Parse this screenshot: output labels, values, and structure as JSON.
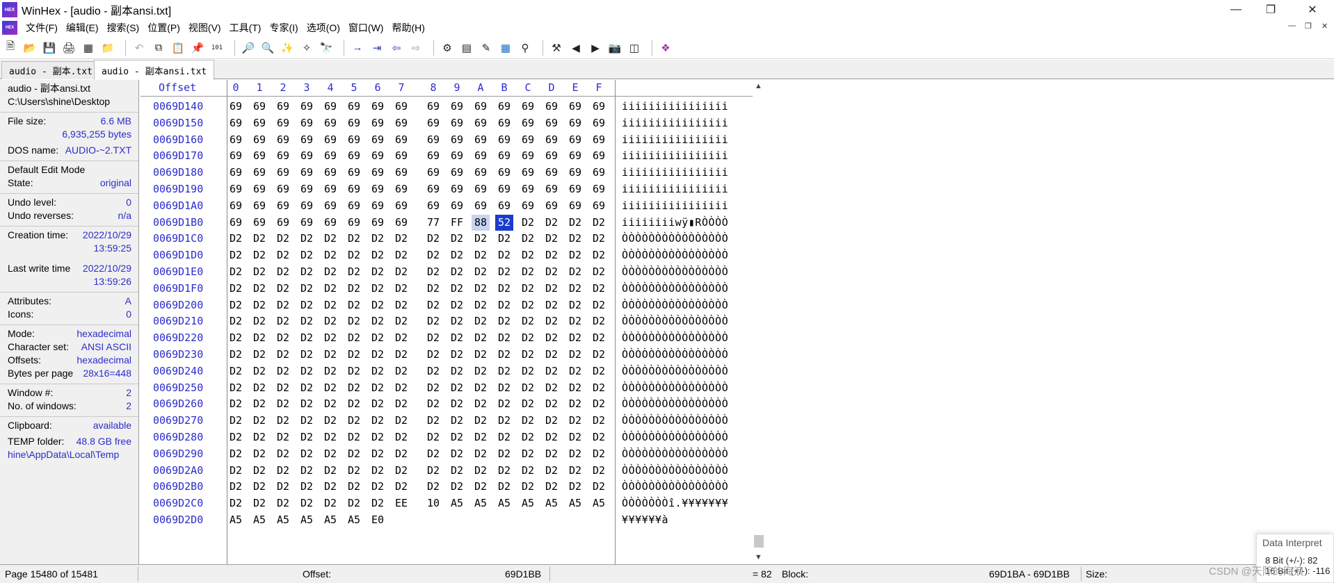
{
  "window": {
    "title": "WinHex - [audio - 副本ansi.txt]",
    "app_icon_label": "HEX",
    "controls": [
      "minimize-icon",
      "restore-icon",
      "close-icon"
    ]
  },
  "menu": {
    "items": [
      "文件(F)",
      "编辑(E)",
      "搜索(S)",
      "位置(P)",
      "视图(V)",
      "工具(T)",
      "专家(I)",
      "选项(O)",
      "窗口(W)",
      "帮助(H)"
    ]
  },
  "tabs": [
    {
      "label": "audio - 副本.txt",
      "active": false
    },
    {
      "label": "audio - 副本ansi.txt",
      "active": true
    }
  ],
  "info": {
    "file_name": "audio - 副本ansi.txt",
    "file_path": "C:\\Users\\shine\\Desktop",
    "file_size_label": "File size:",
    "file_size_mb": "6.6 MB",
    "file_size_bytes": "6,935,255 bytes",
    "dos_name_label": "DOS name:",
    "dos_name": "AUDIO-~2.TXT",
    "edit_mode": "Default Edit Mode",
    "state_label": "State:",
    "state": "original",
    "undo_level_label": "Undo level:",
    "undo_level": "0",
    "undo_reverses_label": "Undo reverses:",
    "undo_reverses": "n/a",
    "creation_label": "Creation time:",
    "creation_date": "2022/10/29",
    "creation_time": "13:59:25",
    "lastwrite_label": "Last write time",
    "lastwrite_date": "2022/10/29",
    "lastwrite_time": "13:59:26",
    "attributes_label": "Attributes:",
    "attributes": "A",
    "icons_label": "Icons:",
    "icons": "0",
    "mode_label": "Mode:",
    "mode": "hexadecimal",
    "charset_label": "Character set:",
    "charset": "ANSI ASCII",
    "offsets_label": "Offsets:",
    "offsets": "hexadecimal",
    "bpp_label": "Bytes per page",
    "bpp": "28x16=448",
    "window_no_label": "Window #:",
    "window_no": "2",
    "windows_label": "No. of windows:",
    "windows": "2",
    "clipboard_label": "Clipboard:",
    "clipboard": "available",
    "temp_label": "TEMP folder:",
    "temp_free": "48.8 GB free",
    "temp_path": "hine\\AppData\\Local\\Temp"
  },
  "hex": {
    "offset_header": "Offset",
    "columns": [
      "0",
      "1",
      "2",
      "3",
      "4",
      "5",
      "6",
      "7",
      "8",
      "9",
      "A",
      "B",
      "C",
      "D",
      "E",
      "F"
    ],
    "rows": [
      {
        "addr": "0069D140",
        "bytes": [
          "69",
          "69",
          "69",
          "69",
          "69",
          "69",
          "69",
          "69",
          "69",
          "69",
          "69",
          "69",
          "69",
          "69",
          "69",
          "69"
        ],
        "text": "iiiiiiiiiiiiiiii"
      },
      {
        "addr": "0069D150",
        "bytes": [
          "69",
          "69",
          "69",
          "69",
          "69",
          "69",
          "69",
          "69",
          "69",
          "69",
          "69",
          "69",
          "69",
          "69",
          "69",
          "69"
        ],
        "text": "iiiiiiiiiiiiiiii"
      },
      {
        "addr": "0069D160",
        "bytes": [
          "69",
          "69",
          "69",
          "69",
          "69",
          "69",
          "69",
          "69",
          "69",
          "69",
          "69",
          "69",
          "69",
          "69",
          "69",
          "69"
        ],
        "text": "iiiiiiiiiiiiiiii"
      },
      {
        "addr": "0069D170",
        "bytes": [
          "69",
          "69",
          "69",
          "69",
          "69",
          "69",
          "69",
          "69",
          "69",
          "69",
          "69",
          "69",
          "69",
          "69",
          "69",
          "69"
        ],
        "text": "iiiiiiiiiiiiiiii"
      },
      {
        "addr": "0069D180",
        "bytes": [
          "69",
          "69",
          "69",
          "69",
          "69",
          "69",
          "69",
          "69",
          "69",
          "69",
          "69",
          "69",
          "69",
          "69",
          "69",
          "69"
        ],
        "text": "iiiiiiiiiiiiiiii"
      },
      {
        "addr": "0069D190",
        "bytes": [
          "69",
          "69",
          "69",
          "69",
          "69",
          "69",
          "69",
          "69",
          "69",
          "69",
          "69",
          "69",
          "69",
          "69",
          "69",
          "69"
        ],
        "text": "iiiiiiiiiiiiiiii"
      },
      {
        "addr": "0069D1A0",
        "bytes": [
          "69",
          "69",
          "69",
          "69",
          "69",
          "69",
          "69",
          "69",
          "69",
          "69",
          "69",
          "69",
          "69",
          "69",
          "69",
          "69"
        ],
        "text": "iiiiiiiiiiiiiiii"
      },
      {
        "addr": "0069D1B0",
        "bytes": [
          "69",
          "69",
          "69",
          "69",
          "69",
          "69",
          "69",
          "69",
          "77",
          "FF",
          "88",
          "52",
          "D2",
          "D2",
          "D2",
          "D2"
        ],
        "text": "iiiiiiiiwÿ▮RÒÒÒÒ"
      },
      {
        "addr": "0069D1C0",
        "bytes": [
          "D2",
          "D2",
          "D2",
          "D2",
          "D2",
          "D2",
          "D2",
          "D2",
          "D2",
          "D2",
          "D2",
          "D2",
          "D2",
          "D2",
          "D2",
          "D2"
        ],
        "text": "ÒÒÒÒÒÒÒÒÒÒÒÒÒÒÒÒ"
      },
      {
        "addr": "0069D1D0",
        "bytes": [
          "D2",
          "D2",
          "D2",
          "D2",
          "D2",
          "D2",
          "D2",
          "D2",
          "D2",
          "D2",
          "D2",
          "D2",
          "D2",
          "D2",
          "D2",
          "D2"
        ],
        "text": "ÒÒÒÒÒÒÒÒÒÒÒÒÒÒÒÒ"
      },
      {
        "addr": "0069D1E0",
        "bytes": [
          "D2",
          "D2",
          "D2",
          "D2",
          "D2",
          "D2",
          "D2",
          "D2",
          "D2",
          "D2",
          "D2",
          "D2",
          "D2",
          "D2",
          "D2",
          "D2"
        ],
        "text": "ÒÒÒÒÒÒÒÒÒÒÒÒÒÒÒÒ"
      },
      {
        "addr": "0069D1F0",
        "bytes": [
          "D2",
          "D2",
          "D2",
          "D2",
          "D2",
          "D2",
          "D2",
          "D2",
          "D2",
          "D2",
          "D2",
          "D2",
          "D2",
          "D2",
          "D2",
          "D2"
        ],
        "text": "ÒÒÒÒÒÒÒÒÒÒÒÒÒÒÒÒ"
      },
      {
        "addr": "0069D200",
        "bytes": [
          "D2",
          "D2",
          "D2",
          "D2",
          "D2",
          "D2",
          "D2",
          "D2",
          "D2",
          "D2",
          "D2",
          "D2",
          "D2",
          "D2",
          "D2",
          "D2"
        ],
        "text": "ÒÒÒÒÒÒÒÒÒÒÒÒÒÒÒÒ"
      },
      {
        "addr": "0069D210",
        "bytes": [
          "D2",
          "D2",
          "D2",
          "D2",
          "D2",
          "D2",
          "D2",
          "D2",
          "D2",
          "D2",
          "D2",
          "D2",
          "D2",
          "D2",
          "D2",
          "D2"
        ],
        "text": "ÒÒÒÒÒÒÒÒÒÒÒÒÒÒÒÒ"
      },
      {
        "addr": "0069D220",
        "bytes": [
          "D2",
          "D2",
          "D2",
          "D2",
          "D2",
          "D2",
          "D2",
          "D2",
          "D2",
          "D2",
          "D2",
          "D2",
          "D2",
          "D2",
          "D2",
          "D2"
        ],
        "text": "ÒÒÒÒÒÒÒÒÒÒÒÒÒÒÒÒ"
      },
      {
        "addr": "0069D230",
        "bytes": [
          "D2",
          "D2",
          "D2",
          "D2",
          "D2",
          "D2",
          "D2",
          "D2",
          "D2",
          "D2",
          "D2",
          "D2",
          "D2",
          "D2",
          "D2",
          "D2"
        ],
        "text": "ÒÒÒÒÒÒÒÒÒÒÒÒÒÒÒÒ"
      },
      {
        "addr": "0069D240",
        "bytes": [
          "D2",
          "D2",
          "D2",
          "D2",
          "D2",
          "D2",
          "D2",
          "D2",
          "D2",
          "D2",
          "D2",
          "D2",
          "D2",
          "D2",
          "D2",
          "D2"
        ],
        "text": "ÒÒÒÒÒÒÒÒÒÒÒÒÒÒÒÒ"
      },
      {
        "addr": "0069D250",
        "bytes": [
          "D2",
          "D2",
          "D2",
          "D2",
          "D2",
          "D2",
          "D2",
          "D2",
          "D2",
          "D2",
          "D2",
          "D2",
          "D2",
          "D2",
          "D2",
          "D2"
        ],
        "text": "ÒÒÒÒÒÒÒÒÒÒÒÒÒÒÒÒ"
      },
      {
        "addr": "0069D260",
        "bytes": [
          "D2",
          "D2",
          "D2",
          "D2",
          "D2",
          "D2",
          "D2",
          "D2",
          "D2",
          "D2",
          "D2",
          "D2",
          "D2",
          "D2",
          "D2",
          "D2"
        ],
        "text": "ÒÒÒÒÒÒÒÒÒÒÒÒÒÒÒÒ"
      },
      {
        "addr": "0069D270",
        "bytes": [
          "D2",
          "D2",
          "D2",
          "D2",
          "D2",
          "D2",
          "D2",
          "D2",
          "D2",
          "D2",
          "D2",
          "D2",
          "D2",
          "D2",
          "D2",
          "D2"
        ],
        "text": "ÒÒÒÒÒÒÒÒÒÒÒÒÒÒÒÒ"
      },
      {
        "addr": "0069D280",
        "bytes": [
          "D2",
          "D2",
          "D2",
          "D2",
          "D2",
          "D2",
          "D2",
          "D2",
          "D2",
          "D2",
          "D2",
          "D2",
          "D2",
          "D2",
          "D2",
          "D2"
        ],
        "text": "ÒÒÒÒÒÒÒÒÒÒÒÒÒÒÒÒ"
      },
      {
        "addr": "0069D290",
        "bytes": [
          "D2",
          "D2",
          "D2",
          "D2",
          "D2",
          "D2",
          "D2",
          "D2",
          "D2",
          "D2",
          "D2",
          "D2",
          "D2",
          "D2",
          "D2",
          "D2"
        ],
        "text": "ÒÒÒÒÒÒÒÒÒÒÒÒÒÒÒÒ"
      },
      {
        "addr": "0069D2A0",
        "bytes": [
          "D2",
          "D2",
          "D2",
          "D2",
          "D2",
          "D2",
          "D2",
          "D2",
          "D2",
          "D2",
          "D2",
          "D2",
          "D2",
          "D2",
          "D2",
          "D2"
        ],
        "text": "ÒÒÒÒÒÒÒÒÒÒÒÒÒÒÒÒ"
      },
      {
        "addr": "0069D2B0",
        "bytes": [
          "D2",
          "D2",
          "D2",
          "D2",
          "D2",
          "D2",
          "D2",
          "D2",
          "D2",
          "D2",
          "D2",
          "D2",
          "D2",
          "D2",
          "D2",
          "D2"
        ],
        "text": "ÒÒÒÒÒÒÒÒÒÒÒÒÒÒÒÒ"
      },
      {
        "addr": "0069D2C0",
        "bytes": [
          "D2",
          "D2",
          "D2",
          "D2",
          "D2",
          "D2",
          "D2",
          "EE",
          "10",
          "A5",
          "A5",
          "A5",
          "A5",
          "A5",
          "A5",
          "A5"
        ],
        "text": "ÒÒÒÒÒÒÒî.¥¥¥¥¥¥¥"
      },
      {
        "addr": "0069D2D0",
        "bytes": [
          "A5",
          "A5",
          "A5",
          "A5",
          "A5",
          "A5",
          "E0"
        ],
        "text": "¥¥¥¥¥¥à"
      }
    ],
    "selection": {
      "row": 7,
      "start": 10,
      "cursor": 11
    }
  },
  "status": {
    "page": "Page 15480 of 15481",
    "offset_label": "Offset:",
    "offset": "69D1BB",
    "value": "= 82",
    "block_label": "Block:",
    "block": "69D1BA - 69D1BB",
    "size_label": "Size:"
  },
  "data_interpreter": {
    "title": "Data Interpret",
    "line1": "8 Bit (+/-): 82",
    "line2": "16 Bit (+/-): -116"
  },
  "watermark": "CSDN @天际的海浪"
}
